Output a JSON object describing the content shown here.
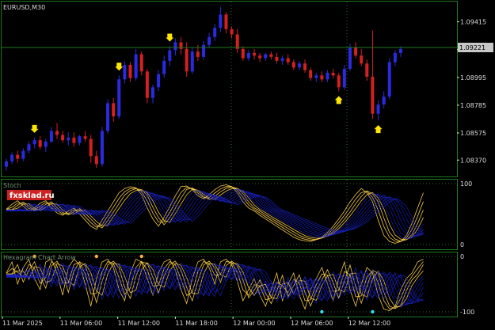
{
  "symbol": "EURUSD,M30",
  "watermark": "fxsklad.ru",
  "indicators": {
    "stoch_label": "Stoch",
    "stoch_rsi_label": "Hexagram Chart Arrow"
  },
  "chart_data": [
    {
      "type": "candlestick",
      "title": "EURUSD,M30",
      "ylim": [
        1.0827,
        1.0955
      ],
      "y_ticks": [
        1.0837,
        1.08575,
        1.08785,
        1.08995,
        1.09205,
        1.09415
      ],
      "y_tick_labels": [
        "1.08370",
        "1.08575",
        "1.08785",
        "1.08995",
        "1.09205",
        "1.09415"
      ],
      "current_price": 1.09221,
      "current_price_label": "1.09221",
      "x_tick_labels": [
        "11 Mar 2025",
        "11 Mar 06:00",
        "11 Mar 12:00",
        "11 Mar 18:00",
        "12 Mar 00:00",
        "12 Mar 06:00",
        "12 Mar 12:00"
      ],
      "candles": [
        [
          1.0832,
          1.0838,
          1.0829,
          1.0836
        ],
        [
          1.0836,
          1.0843,
          1.0834,
          1.0841
        ],
        [
          1.0841,
          1.0844,
          1.0835,
          1.0838
        ],
        [
          1.0838,
          1.0846,
          1.0836,
          1.0844
        ],
        [
          1.0844,
          1.0851,
          1.0842,
          1.0849
        ],
        [
          1.0849,
          1.0854,
          1.0846,
          1.0852
        ],
        [
          1.0852,
          1.0855,
          1.0845,
          1.0847
        ],
        [
          1.0847,
          1.0853,
          1.0843,
          1.0851
        ],
        [
          1.0851,
          1.0862,
          1.085,
          1.0859
        ],
        [
          1.0859,
          1.0865,
          1.0853,
          1.0856
        ],
        [
          1.0856,
          1.0859,
          1.085,
          1.0852
        ],
        [
          1.0852,
          1.0858,
          1.0848,
          1.0854
        ],
        [
          1.0854,
          1.0858,
          1.0847,
          1.085
        ],
        [
          1.085,
          1.0856,
          1.0848,
          1.0855
        ],
        [
          1.0855,
          1.0859,
          1.0851,
          1.0853
        ],
        [
          1.0853,
          1.0856,
          1.0835,
          1.084
        ],
        [
          1.084,
          1.0844,
          1.0831,
          1.0834
        ],
        [
          1.0834,
          1.0862,
          1.0832,
          1.0859
        ],
        [
          1.0859,
          1.0883,
          1.0857,
          1.088
        ],
        [
          1.088,
          1.0884,
          1.0866,
          1.087
        ],
        [
          1.087,
          1.0901,
          1.0868,
          1.0898
        ],
        [
          1.0898,
          1.0912,
          1.0895,
          1.0909
        ],
        [
          1.0909,
          1.0911,
          1.0896,
          1.0899
        ],
        [
          1.0899,
          1.0921,
          1.0897,
          1.0917
        ],
        [
          1.0917,
          1.0919,
          1.0901,
          1.0904
        ],
        [
          1.0904,
          1.0906,
          1.088,
          1.0884
        ],
        [
          1.0884,
          1.0894,
          1.088,
          1.0892
        ],
        [
          1.0892,
          1.0905,
          1.0889,
          1.0902
        ],
        [
          1.0902,
          1.0916,
          1.0899,
          1.0912
        ],
        [
          1.0912,
          1.0923,
          1.0908,
          1.092
        ],
        [
          1.092,
          1.0929,
          1.0916,
          1.0926
        ],
        [
          1.0926,
          1.093,
          1.0917,
          1.0921
        ],
        [
          1.0921,
          1.0926,
          1.09,
          1.0904
        ],
        [
          1.0904,
          1.0922,
          1.0902,
          1.0919
        ],
        [
          1.0919,
          1.0924,
          1.0912,
          1.0915
        ],
        [
          1.0915,
          1.0927,
          1.0913,
          1.0924
        ],
        [
          1.0924,
          1.0933,
          1.0922,
          1.093
        ],
        [
          1.093,
          1.094,
          1.0927,
          1.0937
        ],
        [
          1.0937,
          1.0953,
          1.0934,
          1.0947
        ],
        [
          1.0947,
          1.0949,
          1.0933,
          1.0936
        ],
        [
          1.0936,
          1.0938,
          1.0929,
          1.0932
        ],
        [
          1.0932,
          1.0936,
          1.0918,
          1.0921
        ],
        [
          1.0921,
          1.0923,
          1.0912,
          1.0914
        ],
        [
          1.0914,
          1.092,
          1.0912,
          1.0918
        ],
        [
          1.0918,
          1.0921,
          1.0913,
          1.0916
        ],
        [
          1.0916,
          1.0918,
          1.0911,
          1.0914
        ],
        [
          1.0914,
          1.0918,
          1.0912,
          1.0917
        ],
        [
          1.0917,
          1.0919,
          1.0913,
          1.0915
        ],
        [
          1.0915,
          1.0918,
          1.091,
          1.0912
        ],
        [
          1.0912,
          1.0916,
          1.0909,
          1.0914
        ],
        [
          1.0914,
          1.0917,
          1.0909,
          1.0911
        ],
        [
          1.0911,
          1.0913,
          1.0905,
          1.0907
        ],
        [
          1.0907,
          1.0912,
          1.0905,
          1.091
        ],
        [
          1.091,
          1.0913,
          1.0903,
          1.0905
        ],
        [
          1.0905,
          1.0907,
          1.0897,
          1.0899
        ],
        [
          1.0899,
          1.0903,
          1.0896,
          1.0901
        ],
        [
          1.0901,
          1.0904,
          1.0896,
          1.0898
        ],
        [
          1.0898,
          1.0905,
          1.0896,
          1.0903
        ],
        [
          1.0903,
          1.0906,
          1.0899,
          1.0901
        ],
        [
          1.0901,
          1.0903,
          1.0889,
          1.0892
        ],
        [
          1.0892,
          1.0909,
          1.089,
          1.0906
        ],
        [
          1.0906,
          1.0925,
          1.0904,
          1.0922
        ],
        [
          1.0922,
          1.0926,
          1.0914,
          1.0916
        ],
        [
          1.0916,
          1.0921,
          1.0908,
          1.091
        ],
        [
          1.091,
          1.0913,
          1.0897,
          1.09
        ],
        [
          1.09,
          1.0935,
          1.0868,
          1.0872
        ],
        [
          1.0872,
          1.0882,
          1.0867,
          1.0879
        ],
        [
          1.0879,
          1.0889,
          1.0876,
          1.0885
        ],
        [
          1.0885,
          1.0914,
          1.0883,
          1.0911
        ],
        [
          1.0911,
          1.092,
          1.0908,
          1.0918
        ],
        [
          1.0918,
          1.0923,
          1.0915,
          1.0921
        ]
      ],
      "signal_arrows": [
        {
          "bar": 5,
          "dir": "down"
        },
        {
          "bar": 20,
          "dir": "down"
        },
        {
          "bar": 29,
          "dir": "down"
        },
        {
          "bar": 59,
          "dir": "up"
        },
        {
          "bar": 66,
          "dir": "up"
        }
      ]
    },
    {
      "type": "line",
      "title": "Stoch",
      "ylim": [
        0,
        100
      ],
      "y_tick_labels": [
        "100",
        "0"
      ],
      "y_ticks": [
        100,
        0
      ],
      "series_count": 12,
      "base_values": [
        58,
        66,
        72,
        63,
        55,
        60,
        68,
        72,
        60,
        52,
        48,
        55,
        60,
        50,
        40,
        30,
        25,
        40,
        55,
        70,
        85,
        92,
        95,
        93,
        82,
        60,
        42,
        30,
        45,
        62,
        80,
        95,
        96,
        90,
        80,
        75,
        82,
        90,
        96,
        98,
        95,
        85,
        70,
        60,
        55,
        48,
        42,
        36,
        30,
        24,
        18,
        12,
        8,
        6,
        5,
        8,
        12,
        20,
        30,
        42,
        55,
        70,
        82,
        92,
        85,
        70,
        40,
        15,
        5,
        2,
        5,
        15,
        35,
        60,
        85
      ],
      "highlight_series": [
        0,
        1,
        2,
        3
      ],
      "highlight_color": "#ffd24a",
      "line_color": "#1a22c8"
    },
    {
      "type": "line",
      "title": "Hexagram Chart Arrow",
      "ylim": [
        -100,
        0
      ],
      "y_tick_labels": [
        "0",
        "-100"
      ],
      "y_ticks": [
        0,
        -100
      ],
      "series_count": 12,
      "base_values": [
        -30,
        -10,
        -50,
        -20,
        -5,
        -40,
        -60,
        -10,
        -5,
        -30,
        -70,
        -20,
        -5,
        -15,
        -50,
        -90,
        -40,
        -10,
        -5,
        -20,
        -60,
        -80,
        -30,
        -5,
        -10,
        -40,
        -70,
        -30,
        -10,
        -5,
        -25,
        -60,
        -85,
        -40,
        -10,
        -5,
        -20,
        -50,
        -10,
        -5,
        -15,
        -45,
        -80,
        -60,
        -40,
        -70,
        -90,
        -60,
        -30,
        -80,
        -50,
        -30,
        -70,
        -95,
        -60,
        -40,
        -20,
        -50,
        -80,
        -40,
        -10,
        -60,
        -90,
        -50,
        -20,
        -30,
        -70,
        -95,
        -98,
        -90,
        -60,
        -40,
        -30,
        -10,
        -5
      ],
      "dot_markers": [
        {
          "bar": 5,
          "value": 0,
          "color": "#ffb040"
        },
        {
          "bar": 16,
          "value": 0,
          "color": "#ffb040"
        },
        {
          "bar": 24,
          "value": 0,
          "color": "#ffb040"
        },
        {
          "bar": 56,
          "value": -100,
          "color": "#33ddee"
        },
        {
          "bar": 65,
          "value": -100,
          "color": "#33ddee"
        }
      ],
      "highlight_series": [
        0,
        1,
        2,
        3
      ],
      "highlight_color": "#ffd24a",
      "line_color": "#1a22c8"
    }
  ]
}
